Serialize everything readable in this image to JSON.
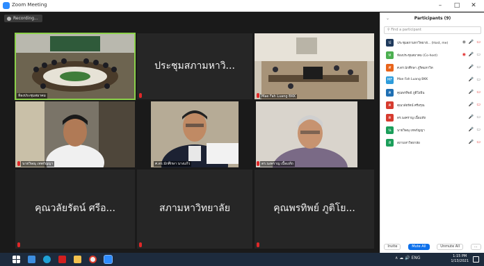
{
  "window": {
    "title": "Zoom Meeting",
    "controls": [
      "–",
      "□",
      "✕"
    ]
  },
  "meeting": {
    "recording_label": "Recording..."
  },
  "tiles": [
    {
      "name": "ห้องประชุมสมาคม",
      "big_name": "",
      "kind": "room-a"
    },
    {
      "name": "",
      "big_name": "ประชุมสภามหาวิ...",
      "kind": "text"
    },
    {
      "name": "Mae Fah Luang BKK",
      "big_name": "",
      "kind": "room-b"
    },
    {
      "name": "นายวิษณุ เทพกัญญา",
      "big_name": "",
      "kind": "person-a"
    },
    {
      "name": "ศ.ดร.นักศึกษา นางแก้ว",
      "big_name": "",
      "kind": "person-b"
    },
    {
      "name": "ดร.นงคราญ เนื้อแท้ถ",
      "big_name": "",
      "kind": "person-c"
    },
    {
      "name": "",
      "big_name": "คุณวลัยรัตน์ ศรีอ...",
      "kind": "text"
    },
    {
      "name": "",
      "big_name": "สภามหาวิทยาลัย",
      "kind": "text"
    },
    {
      "name": "",
      "big_name": "คุณพรทิพย์ ภูติโย...",
      "kind": "text"
    }
  ],
  "participants": {
    "title": "Participants (9)",
    "search_placeholder": "Find a participant",
    "rows": [
      {
        "initial": "ป",
        "name": "ประชุมสภามหาวิทยาลั... (Host, me)",
        "color": "#1f3a5c",
        "icons": [
          "◉",
          "🎤",
          "▭"
        ],
        "muted": true
      },
      {
        "initial": "ห",
        "name": "ห้องประชุมสมาคม (Co-host)",
        "color": "#4caf50",
        "icons": [
          "◉",
          "🎤",
          "▭"
        ],
        "muted": false
      },
      {
        "initial": "ศ",
        "name": "ศ.ดร.นักศึกษา ภูริตมหาวิท",
        "color": "#e8641b",
        "icons": [
          "🎤",
          "▭"
        ],
        "muted": false
      },
      {
        "initial": "MF",
        "name": "Mae Fah Luang BKK",
        "color": "#2d9cdb",
        "icons": [
          "🎤",
          "▭"
        ],
        "muted": true
      },
      {
        "initial": "ค",
        "name": "คุณพรทิพย์ ภูติโยธิน",
        "color": "#1f6fb3",
        "icons": [
          "🎤",
          "▭"
        ],
        "muted": true
      },
      {
        "initial": "ค",
        "name": "คุณวลัยรัตน์ ศรีอรุณ",
        "color": "#d63b2f",
        "icons": [
          "🎤",
          "▭"
        ],
        "muted": true
      },
      {
        "initial": "ด",
        "name": "ดร.นงคราญ เนื้อแท้ถ",
        "color": "#d63b2f",
        "icons": [
          "🎤",
          "▭"
        ],
        "muted": true
      },
      {
        "initial": "น",
        "name": "นายวิษณุ เทพกัญญา",
        "color": "#1b9e5a",
        "icons": [
          "🎤",
          "▭"
        ],
        "muted": true
      },
      {
        "initial": "ส",
        "name": "สภามหาวิทยาลัย",
        "color": "#1b9e5a",
        "icons": [
          "🎤",
          "▭"
        ],
        "muted": true
      }
    ],
    "footer": {
      "invite": "Invite",
      "mute_all": "Mute All",
      "unmute_all": "Unmute All",
      "more": "..."
    }
  },
  "taskbar": {
    "tray": "∧ ☁ 🔊 ENG",
    "time": "1:15 PM",
    "date": "1/13/2021"
  }
}
